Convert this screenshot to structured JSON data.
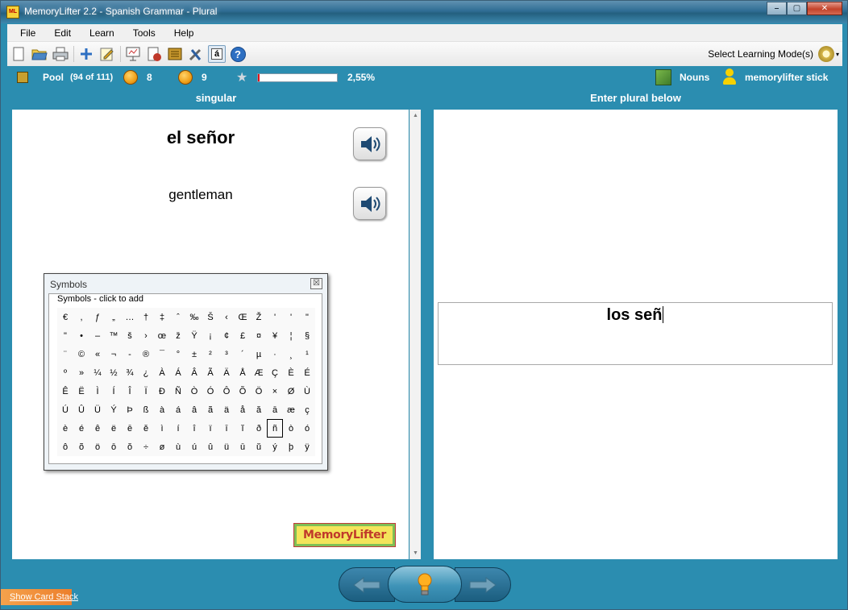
{
  "window": {
    "title": "MemoryLifter 2.2 - Spanish Grammar - Plural",
    "app_icon_text": "ML",
    "buttons": {
      "minimize": "–",
      "maximize": "▢",
      "close": "✕"
    }
  },
  "menu": [
    "File",
    "Edit",
    "Learn",
    "Tools",
    "Help"
  ],
  "toolbar": {
    "icons": [
      "new-file-icon",
      "open-folder-icon",
      "print-icon",
      "add-card-icon",
      "edit-card-icon",
      "presentation-icon",
      "statistics-icon",
      "card-stack-icon",
      "tools-icon",
      "special-character-icon",
      "help-icon"
    ],
    "special_char_label": "á",
    "help_label": "?",
    "mode_label": "Select Learning Mode(s)",
    "mode_caret": "▾"
  },
  "status": {
    "pool_label": "Pool",
    "pool_count": "(94 of 111)",
    "smile_count": "8",
    "sad_count": "9",
    "star": "★",
    "progress_fraction": 0.0255,
    "progress_label": "2,55%",
    "chapter": "Nouns",
    "user": "memorylifter stick"
  },
  "left": {
    "header": "singular",
    "word": "el señor",
    "translation": "gentleman",
    "logo": "MemoryLifter"
  },
  "right": {
    "header": "Enter plural below",
    "answer": "los señ"
  },
  "symbols": {
    "title": "Symbols",
    "close": "☒",
    "group_label": "Symbols - click to add",
    "selected": "ñ",
    "chars": [
      "€",
      ",",
      "ƒ",
      "„",
      "…",
      "†",
      "‡",
      "ˆ",
      "‰",
      "Š",
      "‹",
      "Œ",
      "Ž",
      "'",
      "'",
      "\"",
      "\"",
      "•",
      "–",
      "™",
      "š",
      "›",
      "œ",
      "ž",
      "Ÿ",
      "¡",
      "¢",
      "£",
      "¤",
      "¥",
      "¦",
      "§",
      "¨",
      "©",
      "«",
      "¬",
      "-",
      "®",
      "¯",
      "°",
      "±",
      "²",
      "³",
      "´",
      "µ",
      "·",
      "¸",
      "¹",
      "º",
      "»",
      "¼",
      "½",
      "¾",
      "¿",
      "À",
      "Á",
      "Â",
      "Ã",
      "Ä",
      "Å",
      "Æ",
      "Ç",
      "È",
      "É",
      "Ê",
      "Ë",
      "Ì",
      "Í",
      "Î",
      "Ï",
      "Ð",
      "Ñ",
      "Ò",
      "Ó",
      "Ô",
      "Õ",
      "Ö",
      "×",
      "Ø",
      "Ù",
      "Ú",
      "Û",
      "Ü",
      "Ý",
      "Þ",
      "ß",
      "à",
      "á",
      "â",
      "ã",
      "ä",
      "å",
      "ă",
      "ā",
      "æ",
      "ç",
      "è",
      "é",
      "ê",
      "ë",
      "ē",
      "ě",
      "ì",
      "í",
      "î",
      "ï",
      "ī",
      "ĭ",
      "ð",
      "ñ",
      "ò",
      "ó",
      "ô",
      "õ",
      "ö",
      "ō",
      "ŏ",
      "÷",
      "ø",
      "ù",
      "ú",
      "û",
      "ü",
      "ū",
      "ŭ",
      "ý",
      "þ",
      "ÿ"
    ]
  },
  "footer": {
    "show_stack": "Show Card Stack"
  },
  "colors": {
    "frame": "#2b8db0",
    "accent_red": "#e0141b",
    "logo_bg": "#f4e45a"
  }
}
